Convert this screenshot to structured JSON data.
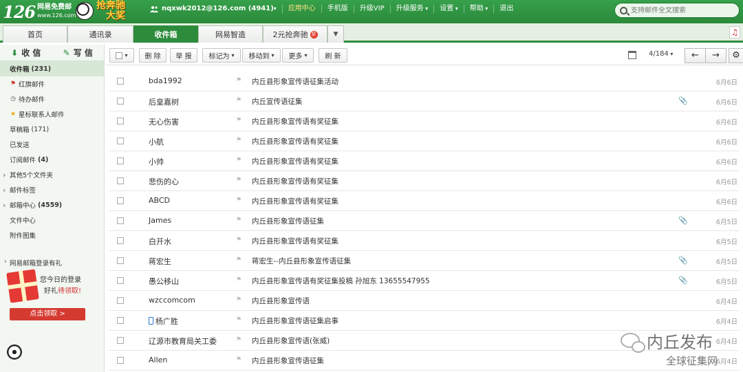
{
  "colors": {
    "brand_green": "#2c8c3c",
    "accent_red": "#d53a31",
    "promo_gold": "#ffd23c"
  },
  "header": {
    "logo_number": "126",
    "logo_line1": "网易免费邮",
    "logo_line2": "www.126.com",
    "promo_line1": "抢奔驰",
    "promo_line2": "大奖",
    "account": "nqxwk2012@126.com (4941)",
    "nav": [
      {
        "label": "应用中心",
        "highlight": true
      },
      {
        "label": "手机版"
      },
      {
        "label": "升级VIP"
      },
      {
        "label": "升级服务",
        "dropdown": true
      },
      {
        "label": "设置",
        "dropdown": true
      },
      {
        "label": "帮助",
        "dropdown": true
      },
      {
        "label": "退出"
      }
    ],
    "search_placeholder": "支持邮件全文搜索"
  },
  "tabs": [
    {
      "label": "首页"
    },
    {
      "label": "通讯录"
    },
    {
      "label": "收件箱",
      "active": true
    },
    {
      "label": "网易智造"
    },
    {
      "label": "2元抢奔驰",
      "badge": "奖"
    }
  ],
  "sidebar": {
    "receive_label": "收 信",
    "write_label": "写 信",
    "folders": [
      {
        "label": "收件箱",
        "count": "(231)",
        "active": true
      },
      {
        "label": "红旗邮件",
        "icon": "flag"
      },
      {
        "label": "待办邮件",
        "icon": "clock"
      },
      {
        "label": "星标联系人邮件",
        "icon": "star"
      },
      {
        "label": "草稿箱",
        "count": "(171)"
      },
      {
        "label": "已发送"
      },
      {
        "label": "订阅邮件",
        "count": "(4)",
        "bold_count": true
      },
      {
        "label": "其他5个文件夹",
        "expandable": true
      },
      {
        "label": "邮件标签",
        "expandable": true
      },
      {
        "label": "邮箱中心",
        "count": "(4559)",
        "bold_count": true,
        "expandable": true
      },
      {
        "label": "文件中心"
      },
      {
        "label": "附件图集"
      }
    ],
    "gift_title": "网易邮箱登录有礼",
    "gift_line1": "您今日的登录",
    "gift_line2a": "好礼",
    "gift_line2b": "待领取!",
    "gift_button": "点击领取 >"
  },
  "toolbar": {
    "delete": "删 除",
    "report": "举 报",
    "mark_as": "标记为",
    "move_to": "移动到",
    "more": "更多",
    "refresh": "刷 新",
    "page_info": "4/184",
    "prev": "←",
    "next": "→",
    "gear": "⚙"
  },
  "mails": [
    {
      "sender": "bda1992",
      "subject": "内丘县形象宣传语征集活动",
      "date": "6月6日"
    },
    {
      "sender": "后皇嘉树",
      "subject": "内丘宣传语征集",
      "date": "6月6日",
      "attach": true
    },
    {
      "sender": "无心伤害",
      "subject": "内丘县形象宣传语有奖征集",
      "date": "6月6日"
    },
    {
      "sender": "小航",
      "subject": "内丘县形象宣传语有奖征集",
      "date": "6月6日"
    },
    {
      "sender": "小帅",
      "subject": "内丘县形象宣传语有奖征集",
      "date": "6月6日"
    },
    {
      "sender": "悲伤的心",
      "subject": "内丘县形象宣传语有奖征集",
      "date": "6月6日"
    },
    {
      "sender": "ABCD",
      "subject": "内丘县形象宣传语有奖征集",
      "date": "6月6日"
    },
    {
      "sender": "James",
      "subject": "内丘县形象宣传语征集",
      "date": "6月5日",
      "attach": true
    },
    {
      "sender": "白开水",
      "subject": "内丘县形象宣传语有奖征集",
      "date": "6月5日"
    },
    {
      "sender": "蒋宏生",
      "subject": "蒋宏生--内丘县形象宣传语征集",
      "date": "6月5日",
      "attach": true
    },
    {
      "sender": "愚公移山",
      "subject": "内丘县形象宣传语有奖征集投稿 孙旭东 13655547955",
      "date": "6月5日",
      "attach": true
    },
    {
      "sender": "wzccomcom",
      "subject": "内丘县形象宣传语",
      "date": "6月4日"
    },
    {
      "sender": "杨广胜",
      "subject": "内丘县形象宣传语征集启事",
      "date": "6月4日",
      "phone": true
    },
    {
      "sender": "辽源市教育局关工委",
      "subject": "内丘县形象宣传语(张威)",
      "date": "6月4日"
    },
    {
      "sender": "Allen",
      "subject": "内丘县形象宣传语征集",
      "date": "6月4日"
    }
  ],
  "watermark": {
    "name": "内丘发布",
    "sub": "全球征集网"
  }
}
